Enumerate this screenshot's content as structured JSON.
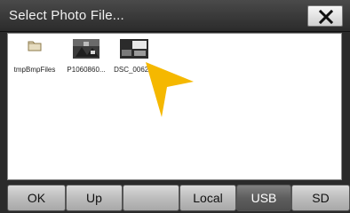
{
  "window": {
    "title": "Select Photo File..."
  },
  "files": [
    {
      "name": "tmpBmpFiles",
      "icon": "folder-icon"
    },
    {
      "name": "P1060860...",
      "icon": "photo-thumbnail"
    },
    {
      "name": "DSC_0062...",
      "icon": "photo-thumbnail"
    }
  ],
  "toolbar": {
    "ok_label": "OK",
    "up_label": "Up",
    "local_label": "Local",
    "usb_label": "USB",
    "sd_label": "SD",
    "active": "USB"
  },
  "colors": {
    "pointer": "#F5B800",
    "active_button": "#5E5E5E"
  }
}
